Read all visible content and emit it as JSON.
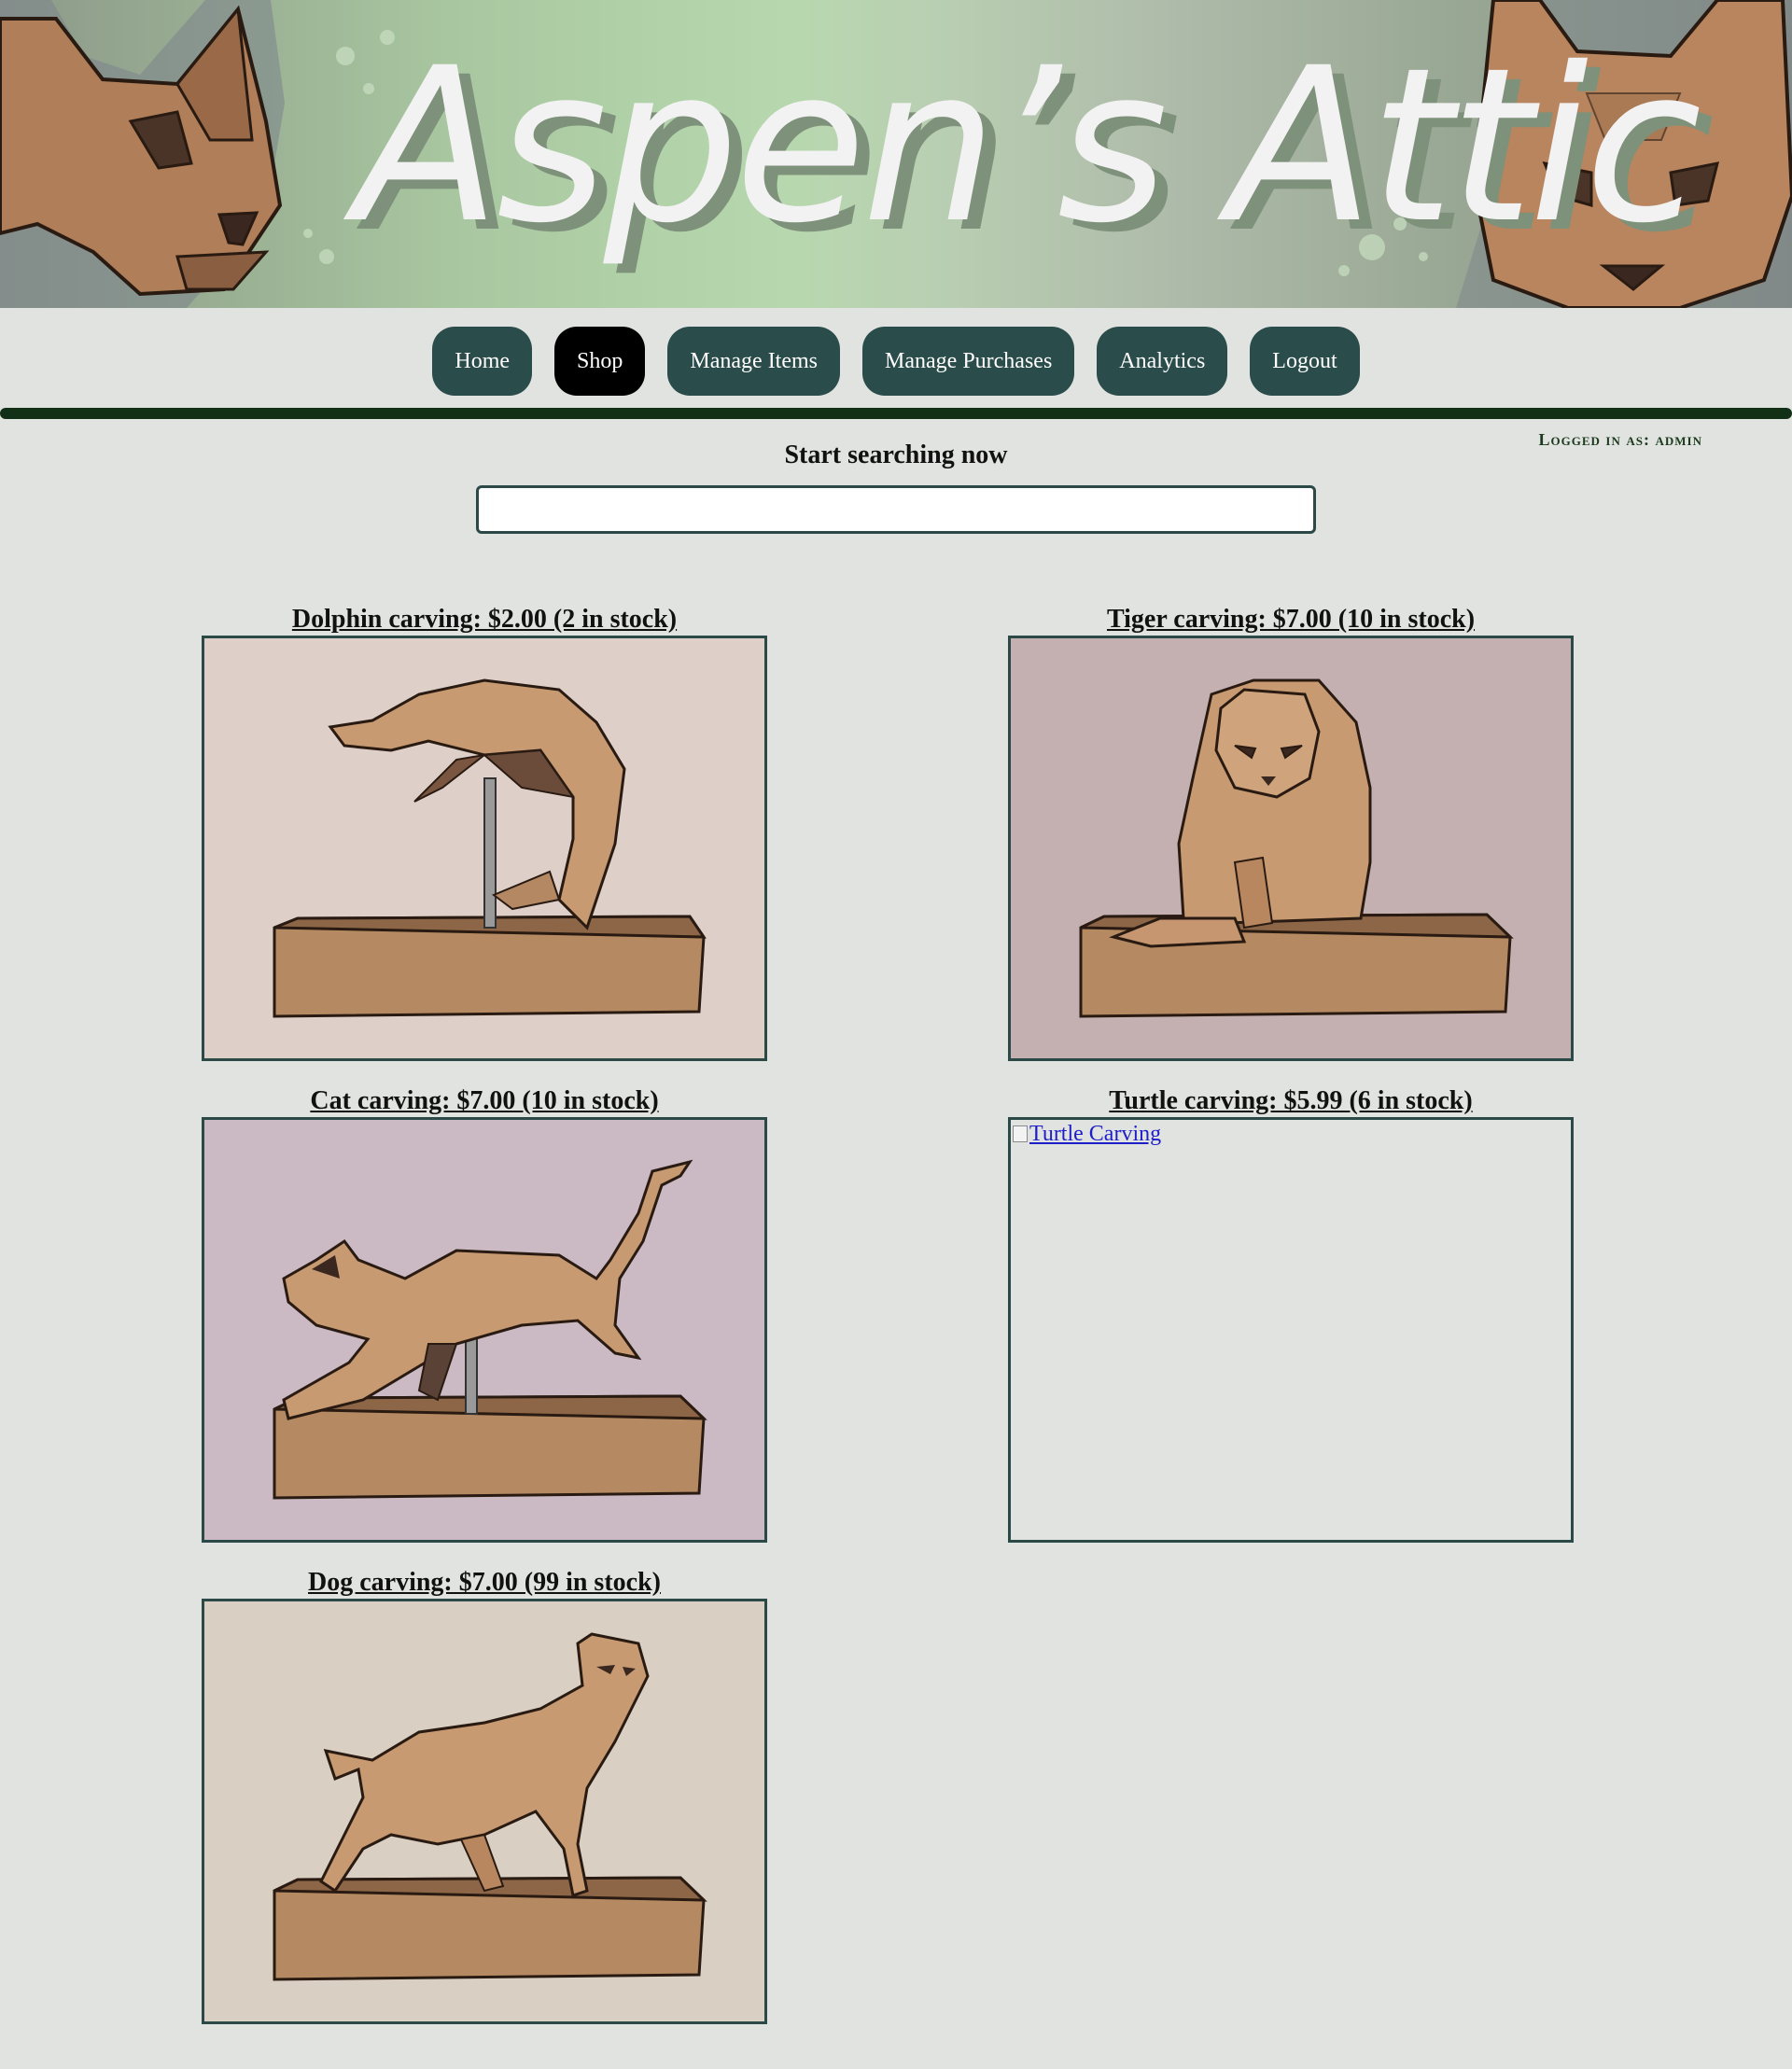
{
  "site": {
    "title": "Aspen’s Attic"
  },
  "nav": {
    "items": [
      {
        "label": "Home",
        "active": false
      },
      {
        "label": "Shop",
        "active": true
      },
      {
        "label": "Manage Items",
        "active": false
      },
      {
        "label": "Manage Purchases",
        "active": false
      },
      {
        "label": "Analytics",
        "active": false
      },
      {
        "label": "Logout",
        "active": false
      }
    ]
  },
  "user": {
    "logged_in_label": "Logged in as: admin"
  },
  "search": {
    "title": "Start searching now",
    "value": "",
    "placeholder": ""
  },
  "products": [
    {
      "title": "Dolphin carving: $2.00 (2 in stock)",
      "image": "dolphin-carving",
      "background": "#ded0c8"
    },
    {
      "title": "Tiger carving: $7.00 (10 in stock)",
      "image": "tiger-carving",
      "background": "#c4b0b0"
    },
    {
      "title": "Cat carving: $7.00 (10 in stock)",
      "image": "cat-carving",
      "background": "#cbb9c4"
    },
    {
      "title": "Turtle carving: $5.99 (6 in stock)",
      "image": "broken-image",
      "alt": "Turtle Carving",
      "background": "#e1e3e0"
    },
    {
      "title": "Dog carving: $7.00 (99 in stock)",
      "image": "dog-carving",
      "background": "#dacfc3"
    }
  ],
  "colors": {
    "page_background": "#e1e3e0",
    "nav_button": "#2a4c4a",
    "nav_button_active": "#000000",
    "divider": "#123015",
    "frame_border": "#2b4a47",
    "wood": "#c7966c"
  }
}
